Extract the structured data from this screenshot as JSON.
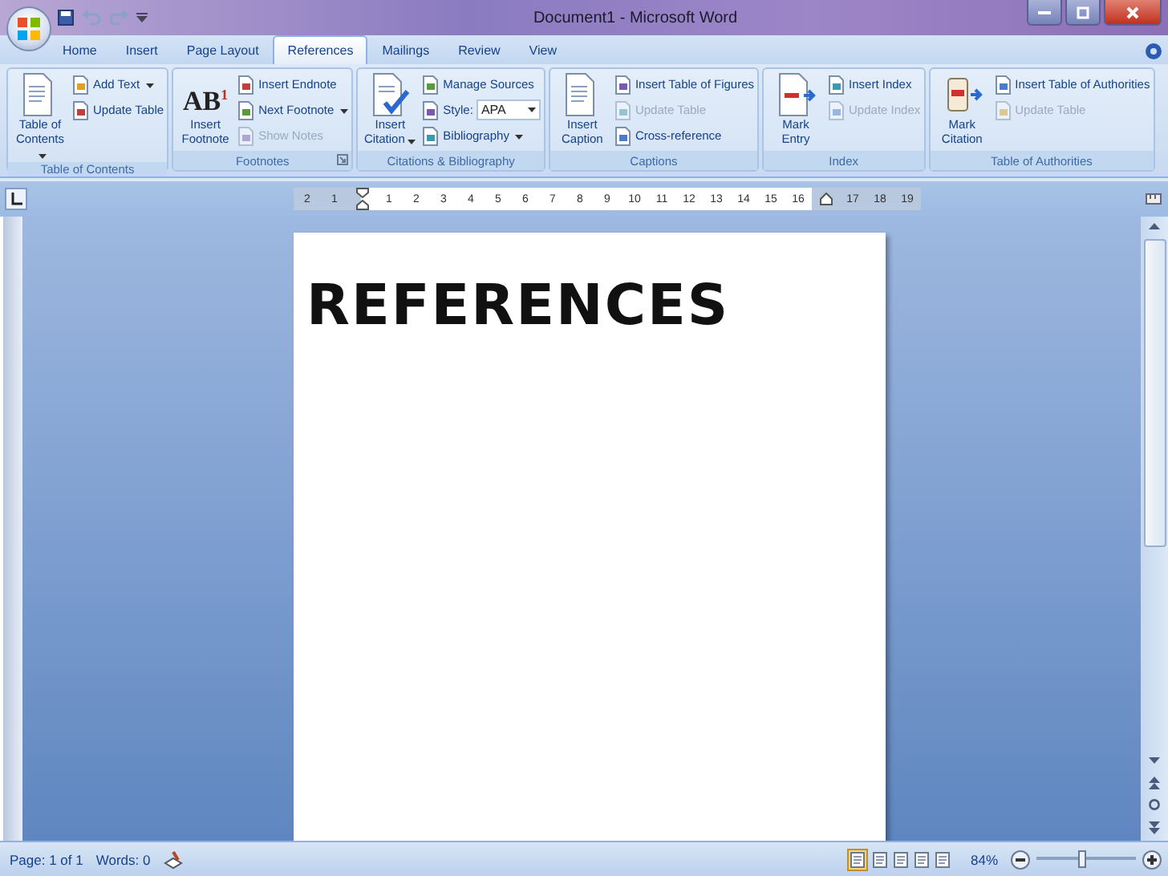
{
  "window": {
    "title": "Document1 - Microsoft Word"
  },
  "tabs": [
    {
      "label": "Home",
      "selected": false
    },
    {
      "label": "Insert",
      "selected": false
    },
    {
      "label": "Page Layout",
      "selected": false
    },
    {
      "label": "References",
      "selected": true
    },
    {
      "label": "Mailings",
      "selected": false
    },
    {
      "label": "Review",
      "selected": false
    },
    {
      "label": "View",
      "selected": false
    }
  ],
  "ribbon": {
    "groups": [
      {
        "label": "Table of Contents",
        "items": [
          {
            "kind": "large",
            "label": "Table of Contents",
            "dropdown": true,
            "disabled": false
          },
          {
            "kind": "small",
            "label": "Add Text",
            "dropdown": true,
            "disabled": false
          },
          {
            "kind": "small",
            "label": "Update Table",
            "disabled": false
          }
        ]
      },
      {
        "label": "Footnotes",
        "launcher": true,
        "items": [
          {
            "kind": "large",
            "label": "Insert Footnote",
            "glyph": "AB$^{1}$",
            "disabled": false
          },
          {
            "kind": "small",
            "label": "Insert Endnote",
            "disabled": false
          },
          {
            "kind": "small",
            "label": "Next Footnote",
            "dropdown": true,
            "disabled": false
          },
          {
            "kind": "small",
            "label": "Show Notes",
            "disabled": true
          }
        ]
      },
      {
        "label": "Citations & Bibliography",
        "items": [
          {
            "kind": "large",
            "label": "Insert Citation",
            "dropdown": true,
            "disabled": false
          },
          {
            "kind": "small",
            "label": "Manage Sources",
            "disabled": false
          },
          {
            "kind": "select",
            "label": "Style:",
            "value": "APA"
          },
          {
            "kind": "small",
            "label": "Bibliography",
            "dropdown": true,
            "disabled": false
          }
        ]
      },
      {
        "label": "Captions",
        "items": [
          {
            "kind": "large",
            "label": "Insert Caption",
            "disabled": false
          },
          {
            "kind": "small",
            "label": "Insert Table of Figures",
            "disabled": false
          },
          {
            "kind": "small",
            "label": "Update Table",
            "disabled": true
          },
          {
            "kind": "small",
            "label": "Cross-reference",
            "disabled": false
          }
        ]
      },
      {
        "label": "Index",
        "items": [
          {
            "kind": "large",
            "label": "Mark Entry",
            "disabled": false
          },
          {
            "kind": "small",
            "label": "Insert Index",
            "disabled": false
          },
          {
            "kind": "small",
            "label": "Update Index",
            "disabled": true
          }
        ]
      },
      {
        "label": "Table of Authorities",
        "items": [
          {
            "kind": "large",
            "label": "Mark Citation",
            "disabled": false
          },
          {
            "kind": "small",
            "label": "Insert Table of Authorities",
            "disabled": false
          },
          {
            "kind": "small",
            "label": "Update Table",
            "disabled": true
          }
        ]
      }
    ]
  },
  "ruler": {
    "left_margin_labels": [
      "2",
      "1"
    ],
    "text_labels": [
      "1",
      "2",
      "3",
      "4",
      "5",
      "6",
      "7",
      "8",
      "9",
      "10",
      "11",
      "12",
      "13",
      "14",
      "15",
      "16"
    ],
    "right_margin_labels": [
      "17",
      "18",
      "19"
    ]
  },
  "document": {
    "heading": "REFERENCES"
  },
  "status_bar": {
    "page": "Page: 1 of 1",
    "words": "Words: 0",
    "zoom": "84%",
    "zoom_level": {
      "level": 0.45
    }
  }
}
